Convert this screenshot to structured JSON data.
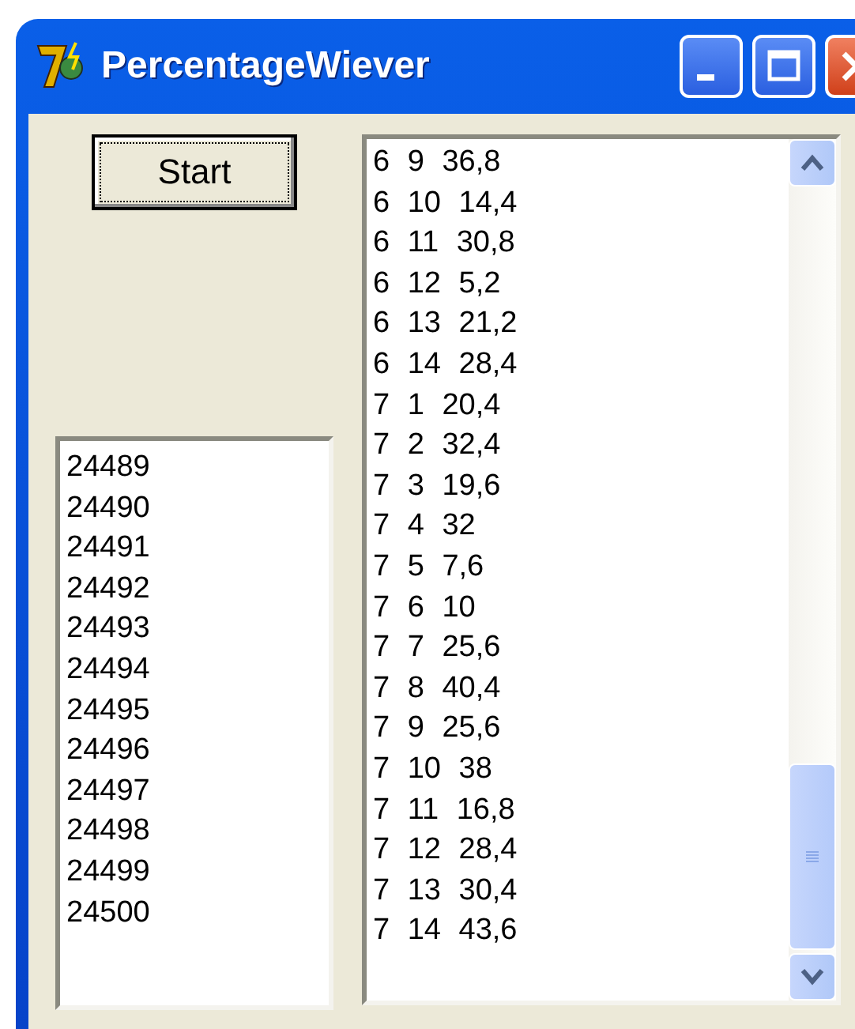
{
  "window": {
    "title": "PercentageWiever"
  },
  "start_button": {
    "label": "Start",
    "focused": true
  },
  "left_list": {
    "items": [
      "24489",
      "24490",
      "24491",
      "24492",
      "24493",
      "24494",
      "24495",
      "24496",
      "24497",
      "24498",
      "24499",
      "24500"
    ]
  },
  "right_list": {
    "items": [
      "6 9 36,8",
      "6 10 14,4",
      "6 11 30,8",
      "6 12 5,2",
      "6 13 21,2",
      "6 14 28,4",
      "7 1 20,4",
      "7 2 32,4",
      "7 3 19,6",
      "7 4 32",
      "7 5 7,6",
      "7 6 10",
      "7 7 25,6",
      "7 8 40,4",
      "7 9 25,6",
      "7 10 38",
      "7 11 16,8",
      "7 12 28,4",
      "7 13 30,4",
      "7 14 43,6"
    ]
  }
}
